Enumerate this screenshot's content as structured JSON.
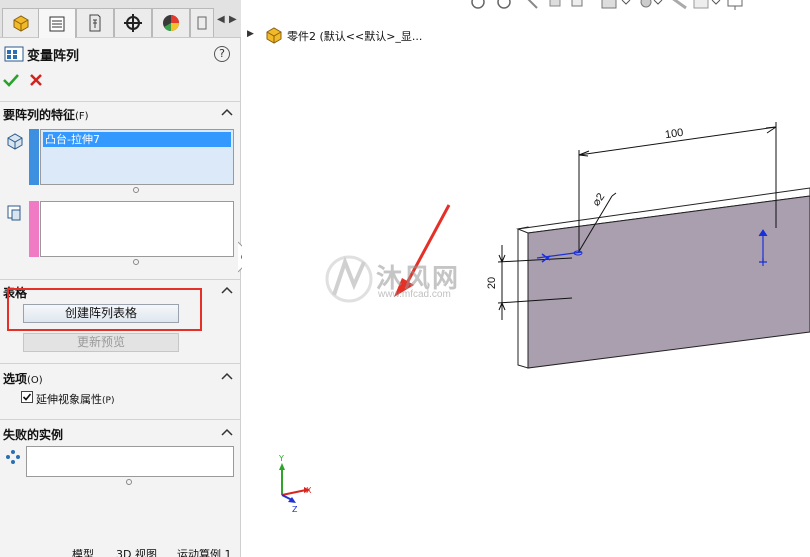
{
  "property_manager": {
    "title": "变量阵列",
    "help": "?",
    "sections": {
      "features": {
        "title": "要阵列的特征",
        "key": "(F)",
        "selected_item": "凸台-拉伸7"
      },
      "table": {
        "title": "表格",
        "create_button": "创建阵列表格",
        "update_button": "更新预览"
      },
      "options": {
        "title": "选项",
        "key": "(O)",
        "propagate_label": "延伸视象属性",
        "propagate_key": "(P)",
        "propagate_checked": true
      },
      "failed": {
        "title": "失败的实例"
      }
    }
  },
  "tree": {
    "text": "零件2  (默认<<默认>_显..."
  },
  "model": {
    "dim_length": "100",
    "dim_hole": "⌀2",
    "dim_height": "20"
  },
  "watermark": {
    "name": "沐风网",
    "url": "www.mfcad.com"
  },
  "bottom_tabs": [
    "模型",
    "3D 视图",
    "运动算例 1"
  ],
  "colors": {
    "selection_blue": "#3399ff",
    "highlight_red": "#e53028",
    "face": "#a99fae"
  }
}
